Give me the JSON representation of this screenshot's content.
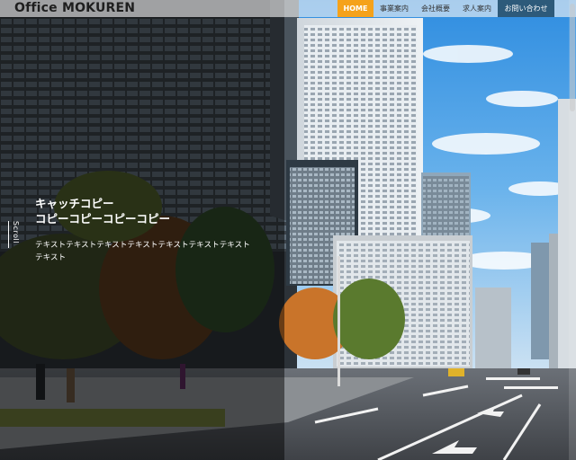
{
  "header": {
    "logo": "Office MOKUREN",
    "nav": [
      {
        "label": "HOME"
      },
      {
        "label": "事業案内"
      },
      {
        "label": "会社概要"
      },
      {
        "label": "求人案内"
      },
      {
        "label": "お問い合わせ"
      }
    ]
  },
  "hero": {
    "catch_line1": "キャッチコピー",
    "catch_line2": "コピーコピーコピーコピー",
    "description": "テキストテキストテキストテキストテキストテキストテキストテキスト",
    "scroll_label": "Scroll"
  },
  "colors": {
    "home_active": "#f5a21a",
    "contact_button": "#2d5a7a"
  }
}
